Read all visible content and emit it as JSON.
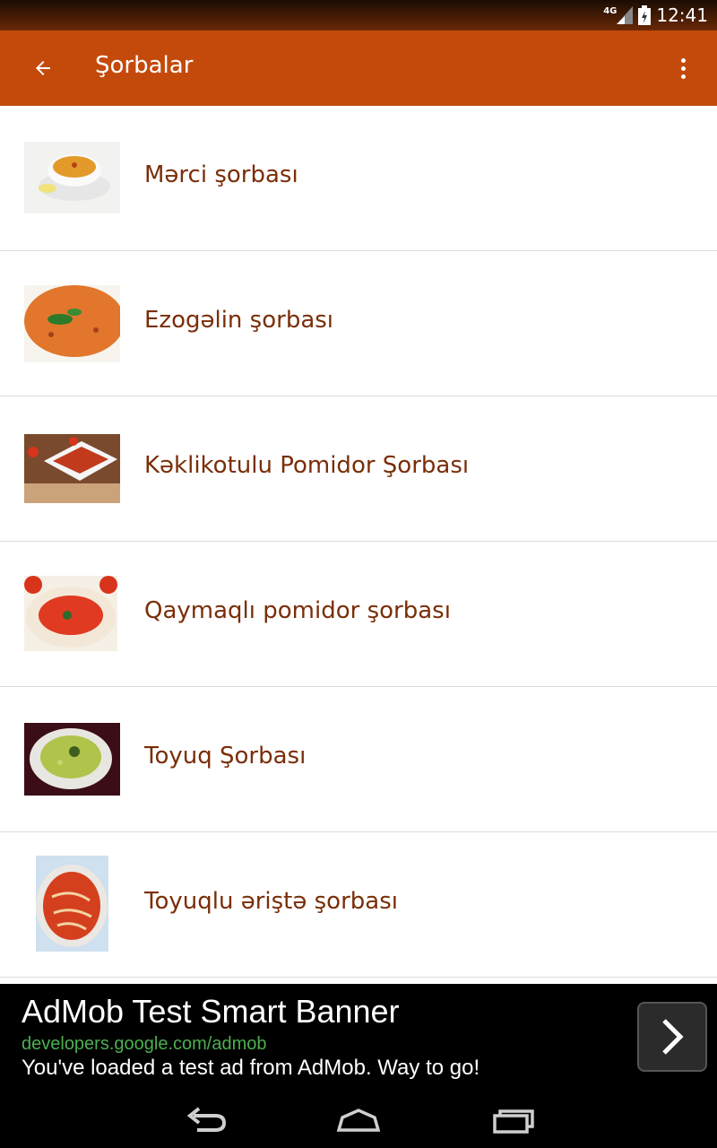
{
  "status_bar": {
    "network": "4G",
    "time": "12:41"
  },
  "app_bar": {
    "title": "Şorbalar",
    "back_icon": "arrow-back-icon",
    "menu_icon": "more-vert-icon"
  },
  "items": [
    {
      "label": "Mərci şorbası",
      "image": "lentil-soup-thumb"
    },
    {
      "label": "Ezogəlin şorbası",
      "image": "ezogelin-soup-thumb"
    },
    {
      "label": "Kəklikotulu Pomidor Şorbası",
      "image": "thyme-tomato-soup-thumb"
    },
    {
      "label": "Qaymaqlı pomidor şorbası",
      "image": "cream-tomato-soup-thumb"
    },
    {
      "label": "Toyuq Şorbası",
      "image": "chicken-soup-thumb"
    },
    {
      "label": "Toyuqlu əriştə şorbası",
      "image": "chicken-noodle-soup-thumb"
    }
  ],
  "ad": {
    "title": "AdMob Test Smart Banner",
    "url": "developers.google.com/admob",
    "text": "You've loaded a test ad from AdMob. Way to go!"
  },
  "colors": {
    "primary": "#c44a0c",
    "item_text": "#7a2e08",
    "ad_url": "#4caf50"
  }
}
